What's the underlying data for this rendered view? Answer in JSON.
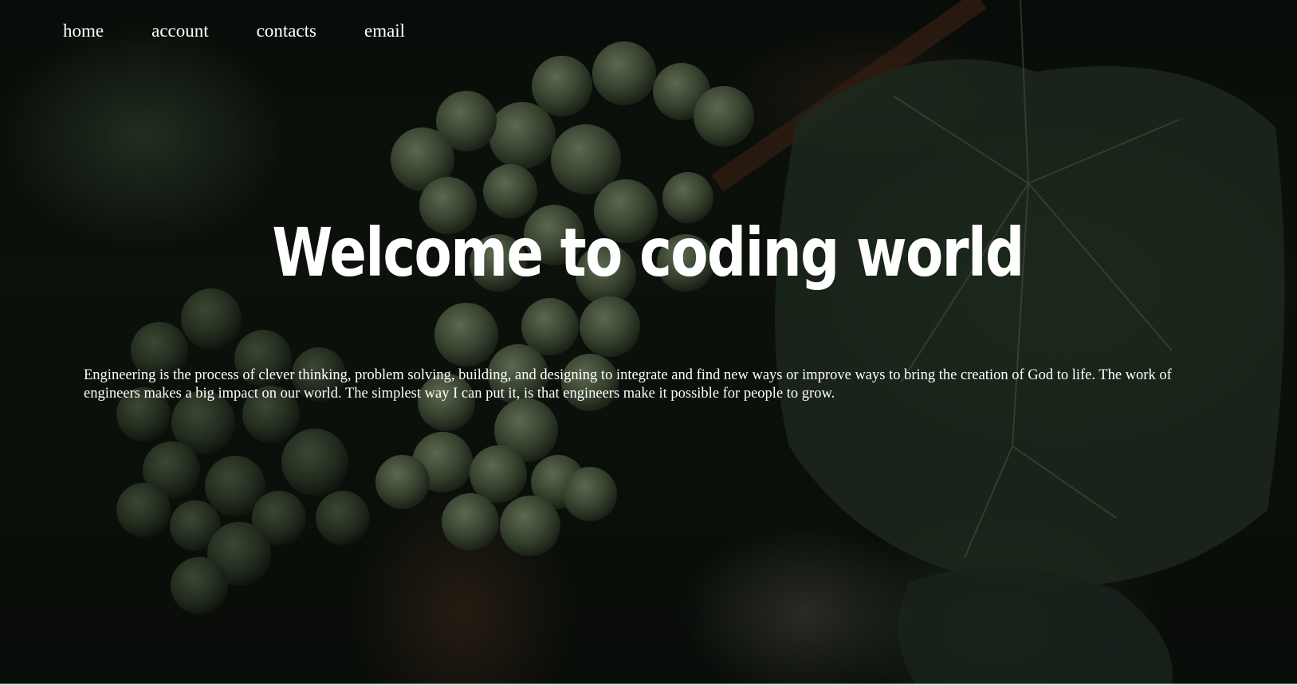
{
  "nav": {
    "items": [
      {
        "label": "home"
      },
      {
        "label": "account"
      },
      {
        "label": "contacts"
      },
      {
        "label": "email"
      }
    ]
  },
  "hero": {
    "title": "Welcome to coding world",
    "paragraph": "Engineering is the process of clever thinking, problem solving, building, and designing to integrate and find new ways or improve ways to bring the creation of God to life. The work of engineers makes a big impact on our world. The simplest way I can put it, is that engineers make it possible for people to grow."
  },
  "background": {
    "subject": "grape-vine-photo",
    "overlay_color": "#000000"
  }
}
